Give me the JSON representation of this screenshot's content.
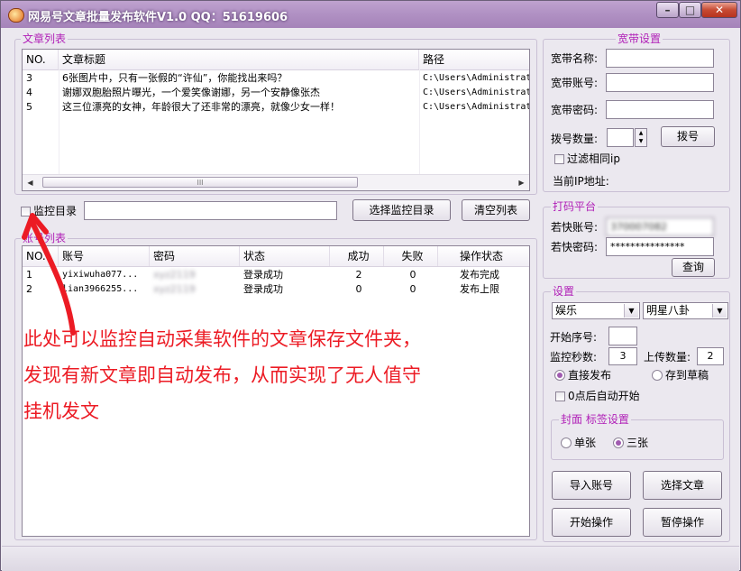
{
  "window": {
    "title": "网易号文章批量发布软件V1.0 QQ：51619606",
    "minimize_glyph": "–",
    "maximize_glyph": "□",
    "close_glyph": "✕"
  },
  "article_list": {
    "group_label": "文章列表",
    "columns": [
      "NO.",
      "文章标题",
      "路径"
    ],
    "rows": [
      {
        "no": "3",
        "title": "6张图片中，只有一张假的“许仙”，你能找出来吗？",
        "path": "C:\\Users\\Administrat"
      },
      {
        "no": "4",
        "title": "谢娜双胞胎照片曝光，一个爱笑像谢娜，另一个安静像张杰",
        "path": "C:\\Users\\Administrat"
      },
      {
        "no": "5",
        "title": "这三位漂亮的女神，年龄很大了还非常的漂亮，就像少女一样！",
        "path": "C:\\Users\\Administrat"
      }
    ],
    "scroll_left": "◀",
    "scroll_right": "▶",
    "scroll_grip": "III"
  },
  "monitor": {
    "checkbox_label": "监控目录",
    "path_value": "",
    "select_button": "选择监控目录",
    "clear_button": "清空列表"
  },
  "account_list": {
    "group_label": "账号列表",
    "columns": [
      "NO.",
      "账号",
      "密码",
      "状态",
      "成功",
      "失败",
      "操作状态"
    ],
    "rows": [
      {
        "no": "1",
        "account": "yixiwuha077...",
        "password": "xyz2119",
        "status": "登录成功",
        "success": "2",
        "fail": "0",
        "op_status": "发布完成"
      },
      {
        "no": "2",
        "account": "lian3966255...",
        "password": "xyz2119",
        "status": "登录成功",
        "success": "0",
        "fail": "0",
        "op_status": "发布上限"
      }
    ]
  },
  "annotation": {
    "line1": "此处可以监控自动采集软件的文章保存文件夹，",
    "line2": "发现有新文章即自动发布，从而实现了无人值守",
    "line3": "挂机发文",
    "color": "#ec1b24"
  },
  "broadband": {
    "group_label": "宽带设置",
    "name_label": "宽带名称:",
    "name_value": "",
    "account_label": "宽带账号:",
    "account_value": "",
    "password_label": "宽带密码:",
    "password_value": "",
    "dial_count_label": "拨号数量:",
    "dial_count_value": "",
    "dial_button": "拨号",
    "filter_ip_label": "过滤相同ip",
    "current_ip_label": "当前IP地址:"
  },
  "captcha": {
    "group_label": "打码平台",
    "account_label": "若快账号:",
    "account_value": "370007082",
    "password_label": "若快密码:",
    "password_value": "***************",
    "query_button": "查询"
  },
  "settings": {
    "group_label": "设置",
    "category_value": "娱乐",
    "subcategory_value": "明星八卦",
    "start_no_label": "开始序号:",
    "start_no_value": "",
    "monitor_seconds_label": "监控秒数:",
    "monitor_seconds_value": "3",
    "upload_count_label": "上传数量:",
    "upload_count_value": "2",
    "publish_direct_label": "直接发布",
    "save_draft_label": "存到草稿",
    "auto_start_label": "0点后自动开始",
    "cover_group_label": "封面 标签设置",
    "single_label": "单张",
    "three_label": "三张"
  },
  "actions": {
    "import_accounts": "导入账号",
    "select_articles": "选择文章",
    "start": "开始操作",
    "pause": "暂停操作"
  }
}
